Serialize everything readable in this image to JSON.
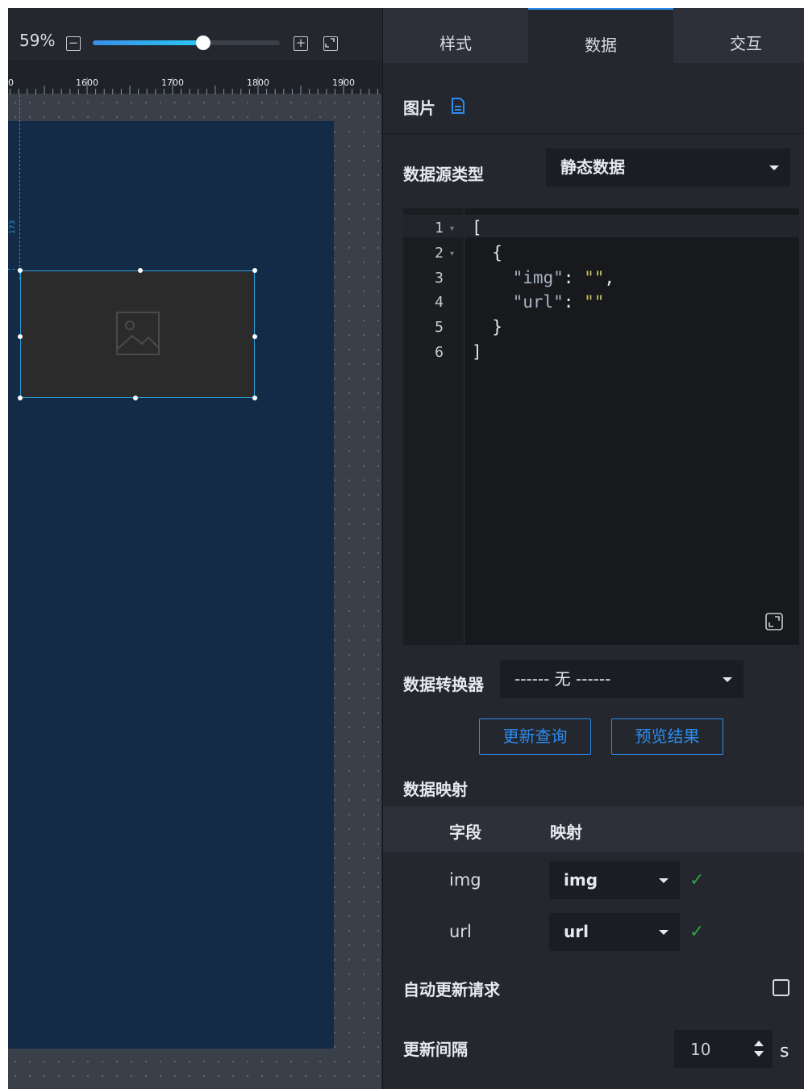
{
  "canvas": {
    "zoom_label": "59%",
    "zoom_value": 0.59,
    "zoom_minus": "−",
    "zoom_plus": "+",
    "ruler_ticks": [
      "0",
      "1600",
      "1700",
      "1800",
      "1900"
    ],
    "guide_label": "173"
  },
  "tabs": [
    {
      "label": "样式",
      "active": false
    },
    {
      "label": "数据",
      "active": true
    },
    {
      "label": "交互",
      "active": false
    }
  ],
  "panel": {
    "title": "图片",
    "datasource_label": "数据源类型",
    "datasource_value": "静态数据",
    "code_lines": [
      {
        "no": "1",
        "fold": "▾"
      },
      {
        "no": "2",
        "fold": "▾"
      },
      {
        "no": "3",
        "fold": ""
      },
      {
        "no": "4",
        "fold": ""
      },
      {
        "no": "5",
        "fold": ""
      },
      {
        "no": "6",
        "fold": ""
      }
    ],
    "code": {
      "l1": "[",
      "l2": "  {",
      "l3_key": "\"img\"",
      "l3_sep": ": ",
      "l3_val": "\"\"",
      "l3_end": ",",
      "l4_key": "\"url\"",
      "l4_sep": ": ",
      "l4_val": "\"\"",
      "l5": "  }",
      "l6": "]"
    },
    "transformer_label": "数据转换器",
    "transformer_value": "------ 无 ------",
    "btn_update": "更新查询",
    "btn_preview": "预览结果",
    "mapping_label": "数据映射",
    "mapping_headers": {
      "field": "字段",
      "mapping": "映射"
    },
    "mapping_rows": [
      {
        "field": "img",
        "value": "img",
        "ok": "✓"
      },
      {
        "field": "url",
        "value": "url",
        "ok": "✓"
      }
    ],
    "auto_update_label": "自动更新请求",
    "auto_update_checked": false,
    "interval_label": "更新间隔",
    "interval_value": "10",
    "interval_unit": "s"
  },
  "colors": {
    "accent": "#2d8cf0",
    "screen_bg": "#142b48",
    "success": "#2ea043"
  }
}
